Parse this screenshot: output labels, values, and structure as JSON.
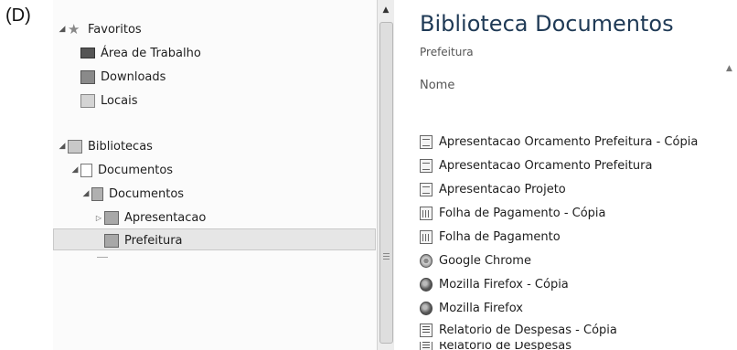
{
  "option_label": "(D)",
  "nav": {
    "favorites": {
      "label": "Favoritos",
      "items": [
        {
          "label": "Área de Trabalho"
        },
        {
          "label": "Downloads"
        },
        {
          "label": "Locais"
        }
      ]
    },
    "libraries": {
      "label": "Bibliotecas",
      "documents_lib": "Documentos",
      "documents_folder": "Documentos",
      "subfolders": [
        {
          "label": "Apresentacao"
        },
        {
          "label": "Prefeitura"
        }
      ]
    }
  },
  "content": {
    "title": "Biblioteca Documentos",
    "subtitle": "Prefeitura",
    "column_header": "Nome",
    "files": [
      {
        "name": "Apresentacao Orcamento Prefeitura - Cópia",
        "icon": "presentation-file-icon"
      },
      {
        "name": "Apresentacao Orcamento Prefeitura",
        "icon": "presentation-file-icon"
      },
      {
        "name": "Apresentacao Projeto",
        "icon": "presentation-file-icon"
      },
      {
        "name": "Folha de Pagamento - Cópia",
        "icon": "spreadsheet-file-icon"
      },
      {
        "name": "Folha de Pagamento",
        "icon": "spreadsheet-file-icon"
      },
      {
        "name": "Google Chrome",
        "icon": "chrome-shortcut-icon"
      },
      {
        "name": "Mozilla Firefox - Cópia",
        "icon": "firefox-shortcut-icon"
      },
      {
        "name": "Mozilla Firefox",
        "icon": "firefox-shortcut-icon"
      },
      {
        "name": "Relatorio de Despesas - Cópia",
        "icon": "word-file-icon"
      },
      {
        "name": "Relatorio de Despesas",
        "icon": "word-file-icon"
      }
    ]
  }
}
